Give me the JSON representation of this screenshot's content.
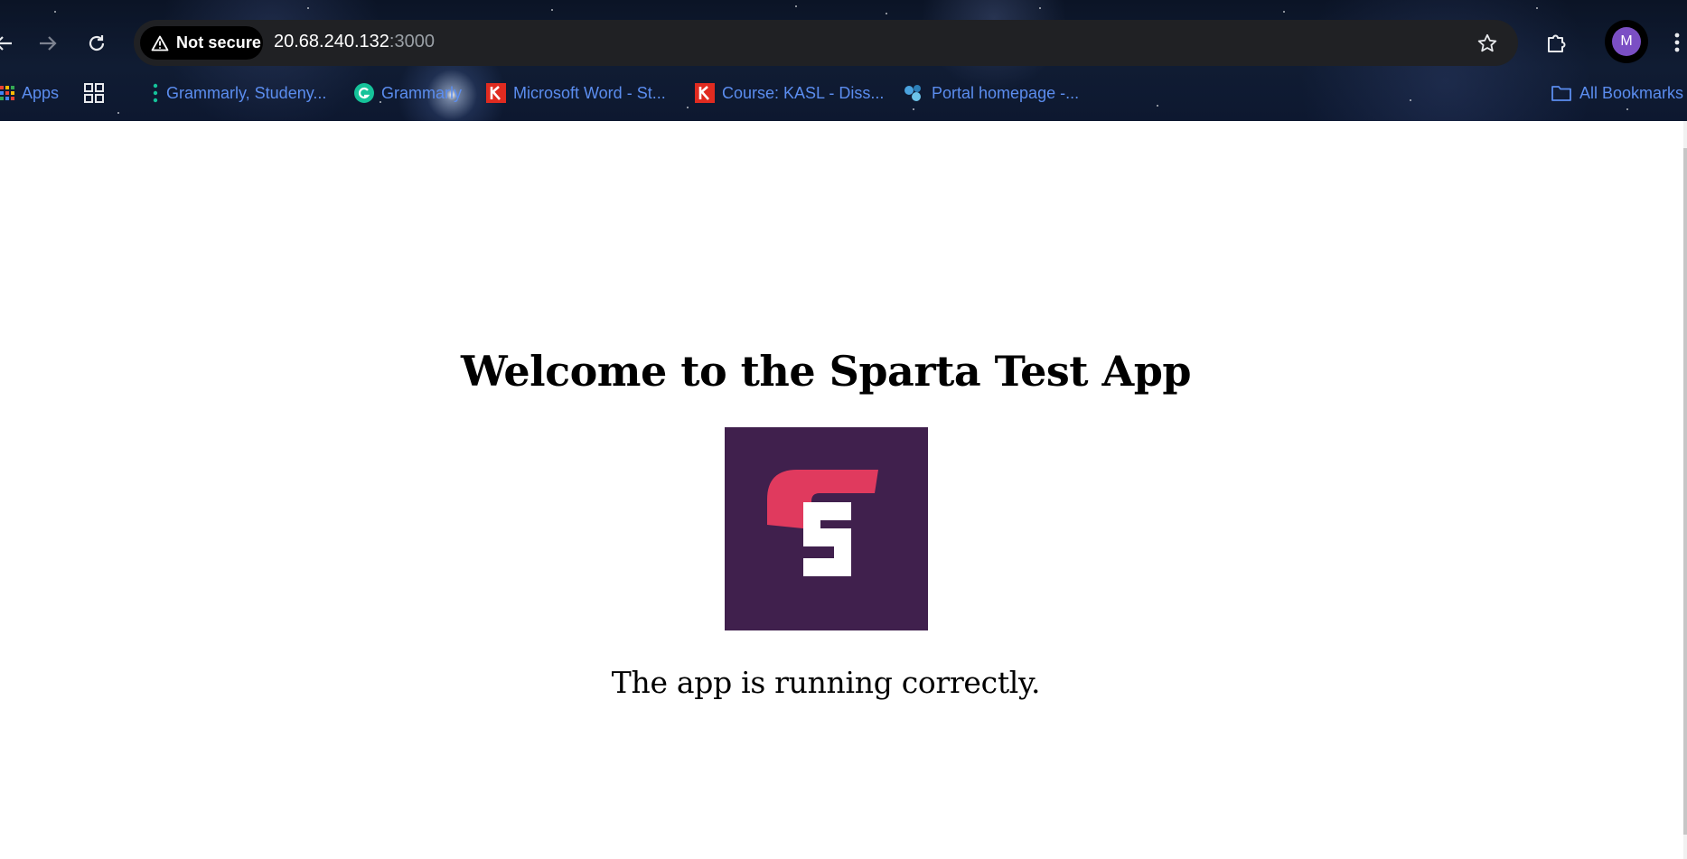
{
  "browser": {
    "security_label": "Not secure",
    "url_host": "20.68.240.132",
    "url_port": ":3000",
    "profile_initial": "M",
    "icons": {
      "back": "arrow-left-icon",
      "forward": "arrow-right-icon",
      "reload": "reload-icon",
      "warning": "warning-triangle-icon",
      "bookmark_star": "star-icon",
      "extensions": "puzzle-icon",
      "menu": "kebab-menu-icon"
    }
  },
  "bookmarks": {
    "items": [
      {
        "label": "Apps",
        "icon": "apps-grid-icon"
      },
      {
        "label": "",
        "icon": "grid-icon"
      },
      {
        "label": "Grammarly, Studeny...",
        "icon": "dots-icon"
      },
      {
        "label": "Grammarly",
        "icon": "grammarly-icon"
      },
      {
        "label": "Microsoft Word - St...",
        "icon": "k-logo-icon"
      },
      {
        "label": "Course: KASL - Diss...",
        "icon": "k-logo-icon"
      },
      {
        "label": "Portal homepage -...",
        "icon": "portal-icon"
      }
    ],
    "all_bookmarks": "All Bookmarks"
  },
  "page": {
    "title": "Welcome to the Sparta Test App",
    "status": "The app is running correctly.",
    "logo": {
      "icon": "sparta-logo",
      "background": "#40204d",
      "accent": "#e03a5e",
      "letter_color": "#ffffff"
    }
  }
}
